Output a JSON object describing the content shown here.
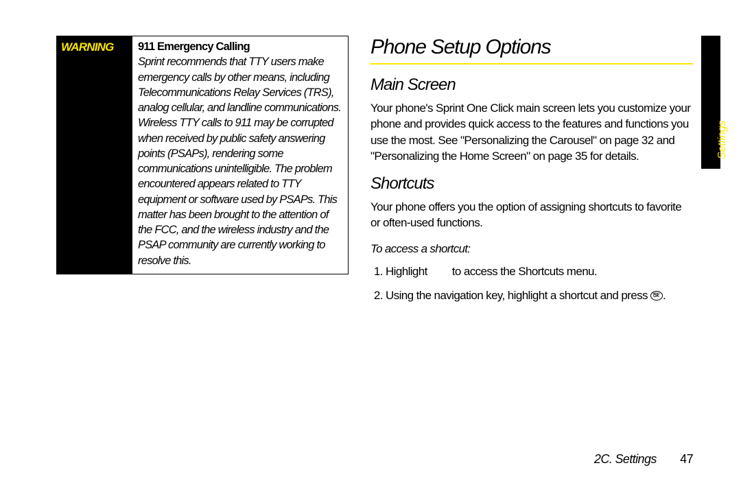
{
  "warning": {
    "label": "WARNING",
    "title": "911 Emergency Calling",
    "body": "Sprint recommends that TTY users make emergency calls by other means, including Telecommunications Relay Services (TRS), analog cellular, and landline communications. Wireless TTY calls to 911 may be corrupted when received by public safety answering points (PSAPs), rendering some communications unintelligible. The problem encountered appears related to TTY equipment or software used by PSAPs. This matter has been brought to the attention of the FCC, and the wireless industry and the PSAP community are currently working to resolve this."
  },
  "section_title": "Phone Setup Options",
  "main_screen": {
    "heading": "Main Screen",
    "body": "Your phone's Sprint One Click main screen lets you customize your phone and provides quick access to the features and functions you use the most. See \"Personalizing the Carousel\" on page 32 and \"Personalizing the Home Screen\" on page 35 for details."
  },
  "shortcuts": {
    "heading": "Shortcuts",
    "intro": "Your phone offers you the option of assigning shortcuts to favorite or often-used functions.",
    "howto": "To access a shortcut:",
    "steps": {
      "s1a": "Highlight",
      "s1b": "to access the Shortcuts menu.",
      "s2a": "Using the navigation key, highlight a shortcut and press",
      "s2b": "."
    }
  },
  "side_tab": "Settings",
  "footer": {
    "section": "2C. Settings",
    "page": "47"
  }
}
